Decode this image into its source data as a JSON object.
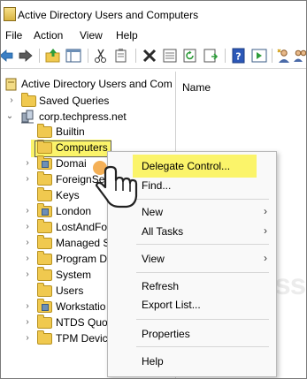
{
  "window": {
    "title": "Active Directory Users and Computers"
  },
  "menu": [
    "File",
    "Action",
    "View",
    "Help"
  ],
  "toolbar": {
    "icons": [
      "back-arrow-icon",
      "forward-arrow-icon",
      "up-folder-icon",
      "console-tree-icon",
      "cut-icon",
      "copy-icon",
      "delete-icon",
      "properties-icon",
      "refresh-icon",
      "export-list-icon",
      "help-icon",
      "action-pane-icon",
      "new-user-icon",
      "new-group-icon"
    ]
  },
  "tree": {
    "root": "Active Directory Users and Com",
    "saved_queries": "Saved Queries",
    "domain": "corp.techpress.net",
    "children": [
      "Builtin",
      "Computers",
      "Domai",
      "ForeignSe",
      "Keys",
      "London",
      "LostAndFo",
      "Managed S",
      "Program D",
      "System",
      "Users",
      "Workstatio",
      "NTDS Quot",
      "TPM Devic"
    ]
  },
  "right_pane": {
    "column_header": "Name"
  },
  "context_menu": {
    "items": [
      "Delegate Control...",
      "Find...",
      "New",
      "All Tasks",
      "View",
      "Refresh",
      "Export List...",
      "Properties",
      "Help"
    ],
    "highlighted": "Delegate Control..."
  },
  "watermark": "hPress.net",
  "colors": {
    "highlight": "#fbf46a",
    "folder": "#f0c94f",
    "menu_bg": "#f9f9f9"
  }
}
